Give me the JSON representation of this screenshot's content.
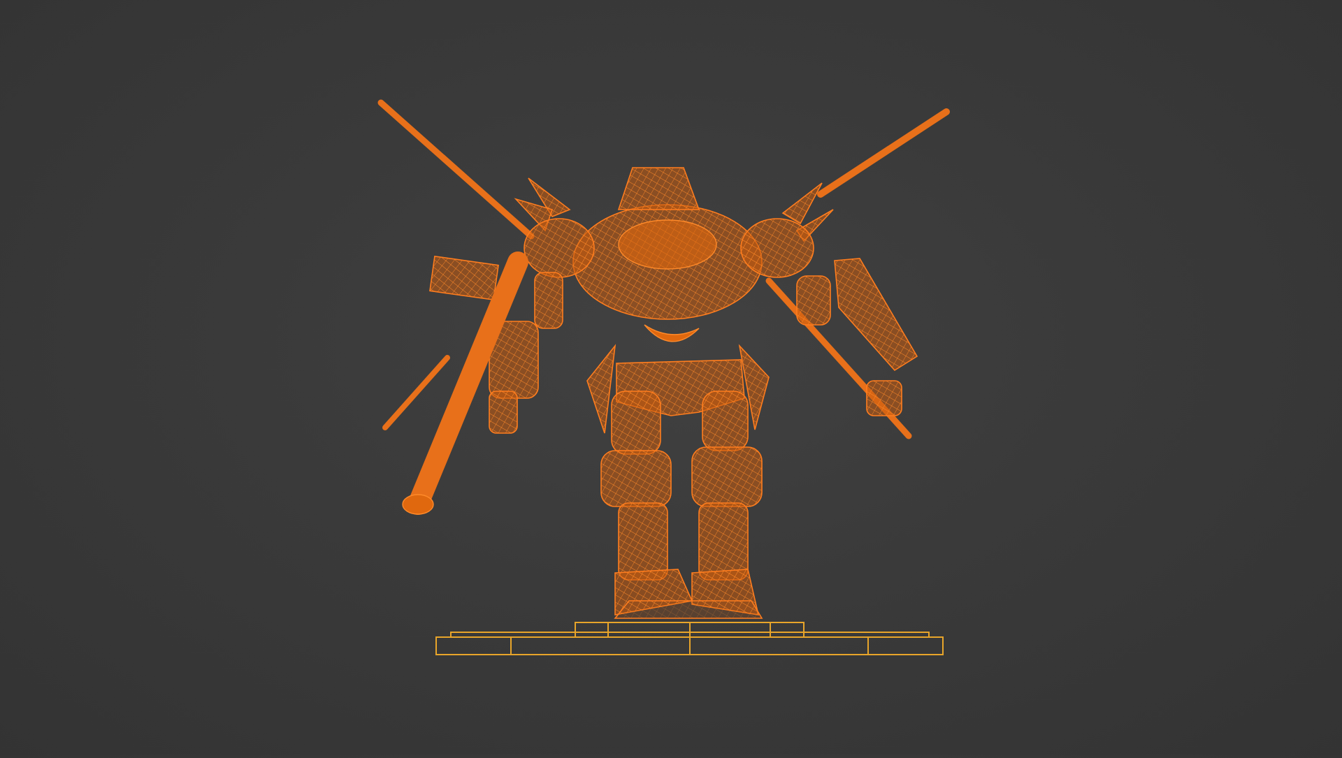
{
  "scene": {
    "colors": {
      "background": "#3a3a3a",
      "wireframe": "#ff7d1e",
      "solid": "#e0680e",
      "base_outline": "#e8a52a"
    }
  }
}
